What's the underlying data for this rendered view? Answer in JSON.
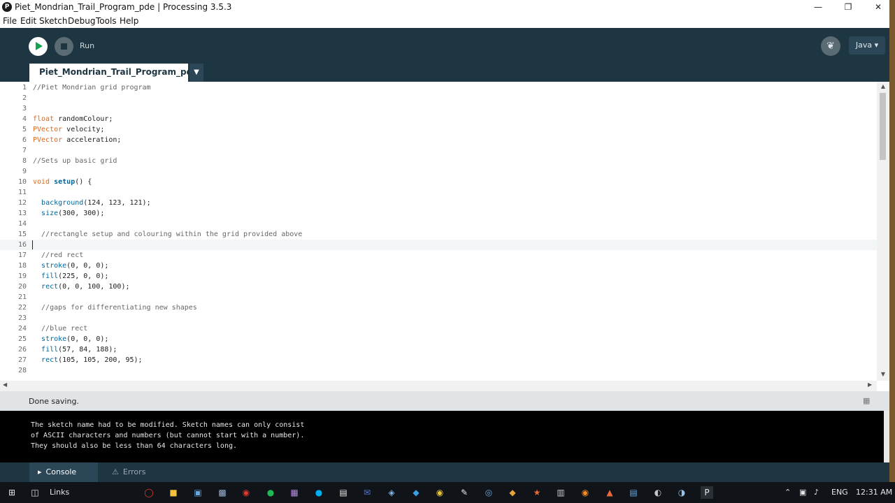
{
  "window": {
    "title": "Piet_Mondrian_Trail_Program_pde | Processing 3.5.3",
    "app_icon": "P"
  },
  "menu": [
    "File",
    "Edit",
    "Sketch",
    "Debug",
    "Tools",
    "Help"
  ],
  "toolbar": {
    "run_label": "Run",
    "mode_label": "Java ▾",
    "debug_icon": "butterfly-icon"
  },
  "tab": {
    "name": "Piet_Mondrian_Trail_Program_pde",
    "menu_arrow": "▼"
  },
  "editor": {
    "lines": [
      {
        "n": "1",
        "text": "//Piet Mondrian grid program"
      },
      {
        "n": "2",
        "text": ""
      },
      {
        "n": "3",
        "text": ""
      },
      {
        "n": "4",
        "text": "float randomColour;"
      },
      {
        "n": "5",
        "text": "PVector velocity;"
      },
      {
        "n": "6",
        "text": "PVector acceleration;"
      },
      {
        "n": "7",
        "text": ""
      },
      {
        "n": "8",
        "text": "//Sets up basic grid"
      },
      {
        "n": "9",
        "text": ""
      },
      {
        "n": "10",
        "text": "void setup() {"
      },
      {
        "n": "11",
        "text": ""
      },
      {
        "n": "12",
        "text": "  background(124, 123, 121);"
      },
      {
        "n": "13",
        "text": "  size(300, 300);"
      },
      {
        "n": "14",
        "text": ""
      },
      {
        "n": "15",
        "text": "  //rectangle setup and colouring within the grid provided above"
      },
      {
        "n": "16",
        "text": ""
      },
      {
        "n": "17",
        "text": "  //red rect"
      },
      {
        "n": "18",
        "text": "  stroke(0, 0, 0);"
      },
      {
        "n": "19",
        "text": "  fill(225, 0, 0);"
      },
      {
        "n": "20",
        "text": "  rect(0, 0, 100, 100);"
      },
      {
        "n": "21",
        "text": ""
      },
      {
        "n": "22",
        "text": "  //gaps for differentiating new shapes"
      },
      {
        "n": "23",
        "text": ""
      },
      {
        "n": "24",
        "text": "  //blue rect"
      },
      {
        "n": "25",
        "text": "  stroke(0, 0, 0);"
      },
      {
        "n": "26",
        "text": "  fill(57, 84, 188);"
      },
      {
        "n": "27",
        "text": "  rect(105, 105, 200, 95);"
      },
      {
        "n": "28",
        "text": ""
      }
    ],
    "current_line": "16"
  },
  "status": {
    "message": "Done saving."
  },
  "console": {
    "lines": [
      "The sketch name had to be modified. Sketch names can only consist",
      "of ASCII characters and numbers (but cannot start with a number).",
      "They should also be less than 64 characters long."
    ]
  },
  "footer": {
    "console_tab": "Console",
    "errors_tab": "Errors"
  },
  "taskbar": {
    "links_label": "Links",
    "language": "ENG",
    "time": "12:31 AM"
  },
  "colors": {
    "toolbar": "#1e3542",
    "run_green": "#14a34f",
    "keyword_orange": "#e2661a",
    "function_blue": "#006699",
    "comment_grey": "#666666"
  }
}
